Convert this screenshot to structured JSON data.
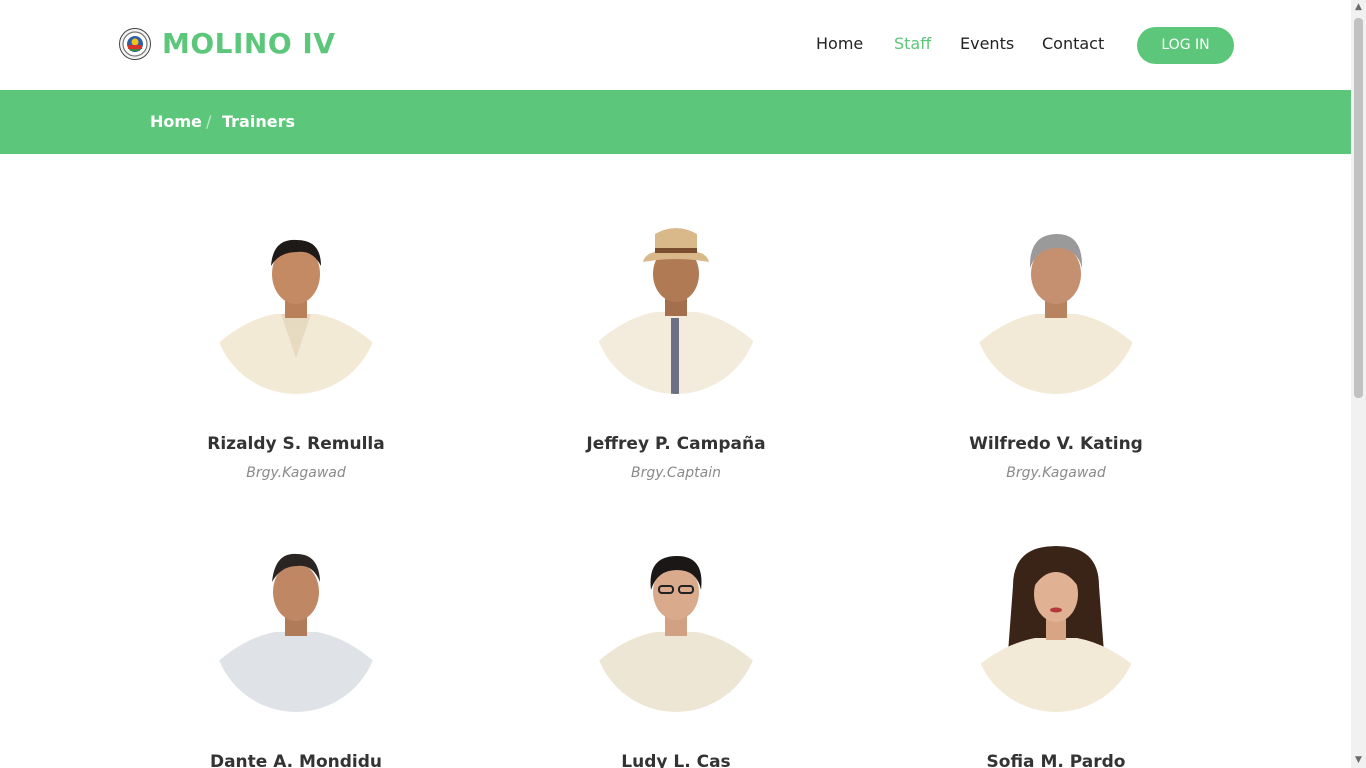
{
  "header": {
    "brand": "MOLINO IV",
    "nav": [
      "Home",
      "Staff",
      "Events",
      "Contact"
    ],
    "active_nav": "Staff",
    "login_label": "LOG IN"
  },
  "breadcrumb": {
    "home": "Home",
    "separator": "/",
    "current": "Trainers"
  },
  "staff": [
    {
      "name": "Rizaldy S. Remulla",
      "role": "Brgy.Kagawad"
    },
    {
      "name": "Jeffrey P. Campaña",
      "role": "Brgy.Captain"
    },
    {
      "name": "Wilfredo V. Kating",
      "role": "Brgy.Kagawad"
    },
    {
      "name": "Dante A. Mondidu",
      "role": ""
    },
    {
      "name": "Ludy L. Cas",
      "role": ""
    },
    {
      "name": "Sofia M. Pardo",
      "role": ""
    }
  ],
  "colors": {
    "accent": "#5cc77a",
    "text": "#333333",
    "muted": "#8a8a8a"
  }
}
